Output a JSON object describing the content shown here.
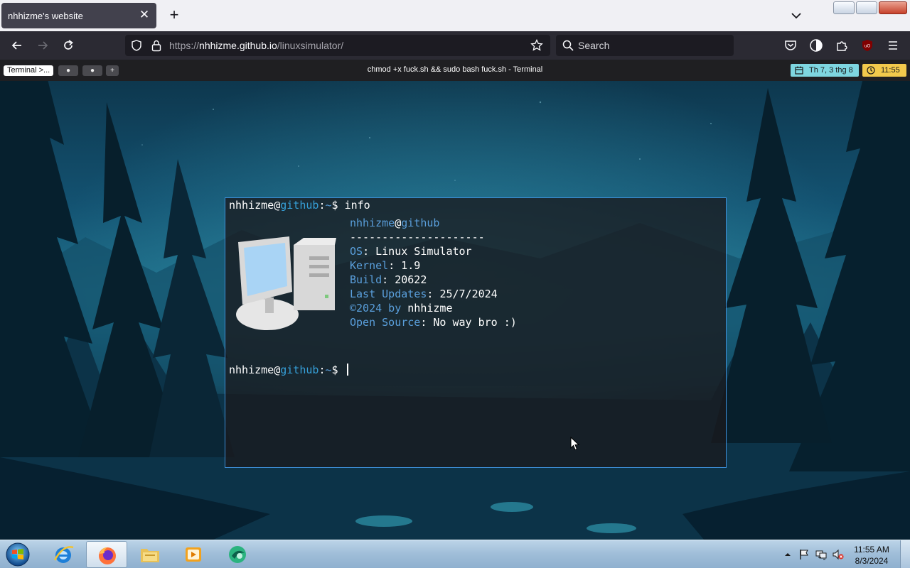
{
  "browser": {
    "tab_title": "nhhizme's website",
    "url_scheme": "https://",
    "url_host": "nhhizme.github.io",
    "url_path": "/linuxsimulator/",
    "search_placeholder": "Search"
  },
  "desktop": {
    "workspaces": [
      {
        "label": "Terminal >..."
      },
      {
        "label": "●"
      },
      {
        "label": "●"
      },
      {
        "label": "+"
      }
    ],
    "window_title": "chmod +x fuck.sh && sudo bash fuck.sh - Terminal",
    "date": "Th 7, 3 thg 8",
    "time": "11:55"
  },
  "terminal": {
    "prompt_user": "nhhizme@",
    "prompt_host": "github",
    "prompt_sep": ":",
    "prompt_path": "~",
    "prompt_sign": "$ ",
    "command": "info",
    "info": {
      "user": "nhhizme",
      "at": "@",
      "host": "github",
      "divider": "---------------------",
      "os_key": "OS",
      "os_val": "Linux Simulator",
      "kernel_key": "Kernel",
      "kernel_val": "1.9",
      "build_key": "Build",
      "build_val": "20622",
      "updates_key": "Last Updates",
      "updates_val": "25/7/2024",
      "copyright_key": "©2024 by",
      "copyright_val": "nhhizme",
      "source_key": "Open Source",
      "source_val": "No way bro :)"
    }
  },
  "taskbar": {
    "clock_time": "11:55 AM",
    "clock_date": "8/3/2024"
  },
  "colors": {
    "terminal_border": "#3d8fd8",
    "terminal_host": "#36a0d8",
    "terminal_key": "#5a9fdc",
    "date_pill": "#7ed6e0",
    "time_pill": "#f2c94c"
  }
}
